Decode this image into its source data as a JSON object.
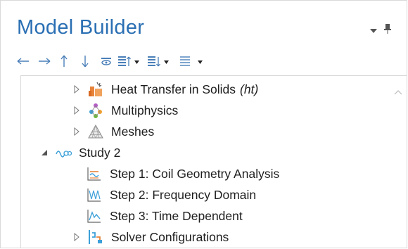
{
  "panel": {
    "title": "Model Builder"
  },
  "toolbar": {
    "buttons": [
      {
        "name": "back-icon"
      },
      {
        "name": "forward-icon"
      },
      {
        "name": "up-icon"
      },
      {
        "name": "down-icon"
      },
      {
        "name": "show-icon"
      },
      {
        "name": "expand-sections-icon"
      },
      {
        "name": "collapse-sections-icon"
      },
      {
        "name": "list-view-icon"
      }
    ]
  },
  "tree": {
    "heat_transfer": {
      "label": "Heat Transfer in Solids",
      "tag": "(ht)"
    },
    "multiphysics": {
      "label": "Multiphysics"
    },
    "meshes": {
      "label": "Meshes"
    },
    "study": {
      "label": "Study 2"
    },
    "step1": {
      "label": "Step 1: Coil Geometry Analysis"
    },
    "step2": {
      "label": "Step 2: Frequency Domain"
    },
    "step3": {
      "label": "Step 3: Time Dependent"
    },
    "solver": {
      "label": "Solver Configurations"
    }
  },
  "colors": {
    "accent": "#2a6fb3",
    "icon_blue": "#4a7fb8",
    "heat_orange": "#e8833a"
  }
}
